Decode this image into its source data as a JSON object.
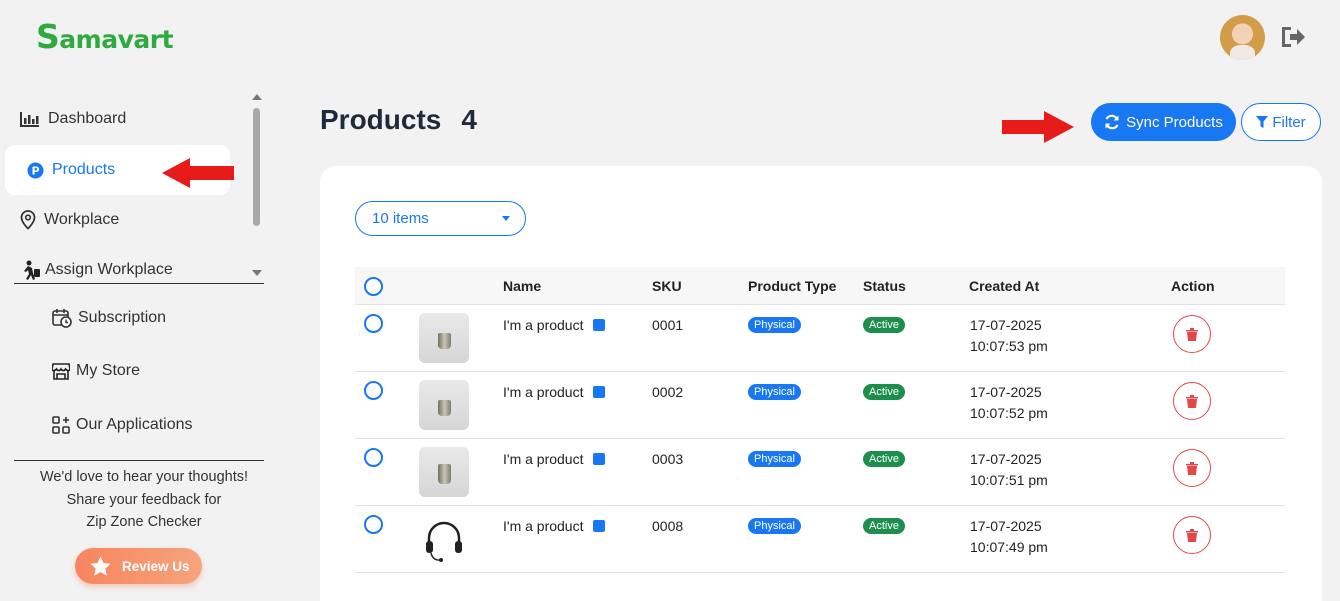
{
  "header": {
    "logo_text": "amavart",
    "logo_initial": "S"
  },
  "sidebar": {
    "items": [
      {
        "label": "Dashboard",
        "icon": "chart-bar-icon"
      },
      {
        "label": "Products",
        "icon": "product-p-icon"
      },
      {
        "label": "Workplace",
        "icon": "map-pin-icon"
      },
      {
        "label": "Assign Workplace",
        "icon": "person-walking-luggage-icon"
      }
    ],
    "bottom_items": [
      {
        "label": "Subscription",
        "icon": "calendar-clock-icon"
      },
      {
        "label": "My Store",
        "icon": "store-icon"
      },
      {
        "label": "Our Applications",
        "icon": "apps-grid-icon"
      }
    ],
    "feedback_lines": [
      "We'd love to hear your thoughts!",
      "Share your feedback for",
      "Zip Zone Checker"
    ],
    "review_label": "Review Us"
  },
  "main": {
    "title": "Products",
    "count": "4",
    "sync_label": "Sync Products",
    "filter_label": "Filter",
    "page_size": "10 items"
  },
  "table": {
    "columns": [
      "Name",
      "SKU",
      "Product Type",
      "Status",
      "Created At",
      "Action"
    ],
    "rows": [
      {
        "name": "I'm a product",
        "sku": "0001",
        "type": "Physical",
        "status": "Active",
        "date": "17-07-2025",
        "time": "10:07:53 pm",
        "thumb": "cup"
      },
      {
        "name": "I'm a product",
        "sku": "0002",
        "type": "Physical",
        "status": "Active",
        "date": "17-07-2025",
        "time": "10:07:52 pm",
        "thumb": "cup"
      },
      {
        "name": "I'm a product",
        "sku": "0003",
        "type": "Physical",
        "status": "Active",
        "date": "17-07-2025",
        "time": "10:07:51 pm",
        "thumb": "cup"
      },
      {
        "name": "I'm a product",
        "sku": "0008",
        "type": "Physical",
        "status": "Active",
        "date": "17-07-2025",
        "time": "10:07:49 pm",
        "thumb": "headset"
      }
    ]
  },
  "colors": {
    "brand": "#2eaa3f",
    "accent": "#1877f2",
    "active": "#1e8e4e",
    "danger": "#e04949",
    "arrow": "#e81b1b"
  }
}
